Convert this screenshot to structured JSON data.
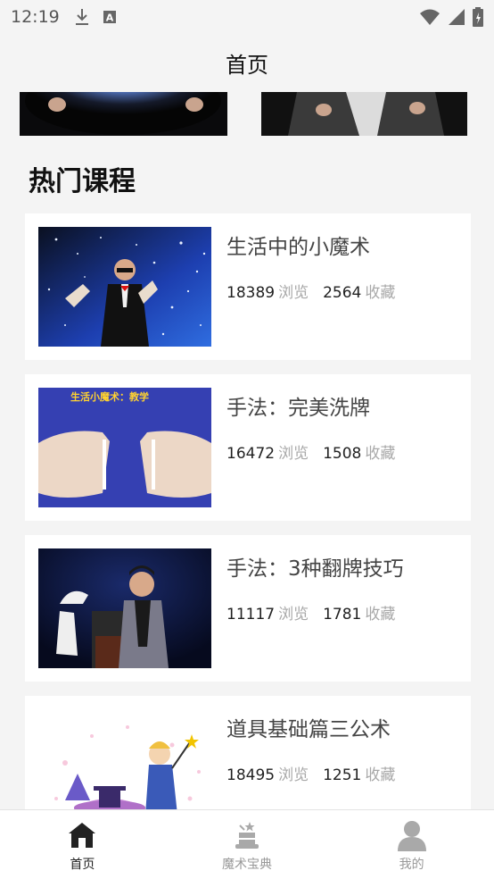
{
  "status_bar": {
    "time": "12:19",
    "icons": [
      "download-icon",
      "a-icon",
      "wifi-icon",
      "signal-icon",
      "battery-icon"
    ]
  },
  "header": {
    "title": "首页"
  },
  "section": {
    "title": "热门课程"
  },
  "courses": [
    {
      "title": "生活中的小魔术",
      "views": "18389",
      "views_label": "浏览",
      "favorites": "2564",
      "favorites_label": "收藏"
    },
    {
      "title": "手法：完美洗牌",
      "views": "16472",
      "views_label": "浏览",
      "favorites": "1508",
      "favorites_label": "收藏",
      "thumb_caption": "生活小魔术：教学"
    },
    {
      "title": "手法：3种翻牌技巧",
      "views": "11117",
      "views_label": "浏览",
      "favorites": "1781",
      "favorites_label": "收藏"
    },
    {
      "title": "道具基础篇三公术",
      "views": "18495",
      "views_label": "浏览",
      "favorites": "1251",
      "favorites_label": "收藏"
    }
  ],
  "tabs": [
    {
      "label": "首页",
      "icon": "home-icon",
      "active": true
    },
    {
      "label": "魔术宝典",
      "icon": "magic-hat-icon",
      "active": false
    },
    {
      "label": "我的",
      "icon": "user-icon",
      "active": false
    }
  ],
  "colors": {
    "background": "#f4f4f4",
    "card": "#ffffff",
    "muted": "#a8a8a8",
    "active_tab": "#222222",
    "inactive_tab": "#999999"
  }
}
